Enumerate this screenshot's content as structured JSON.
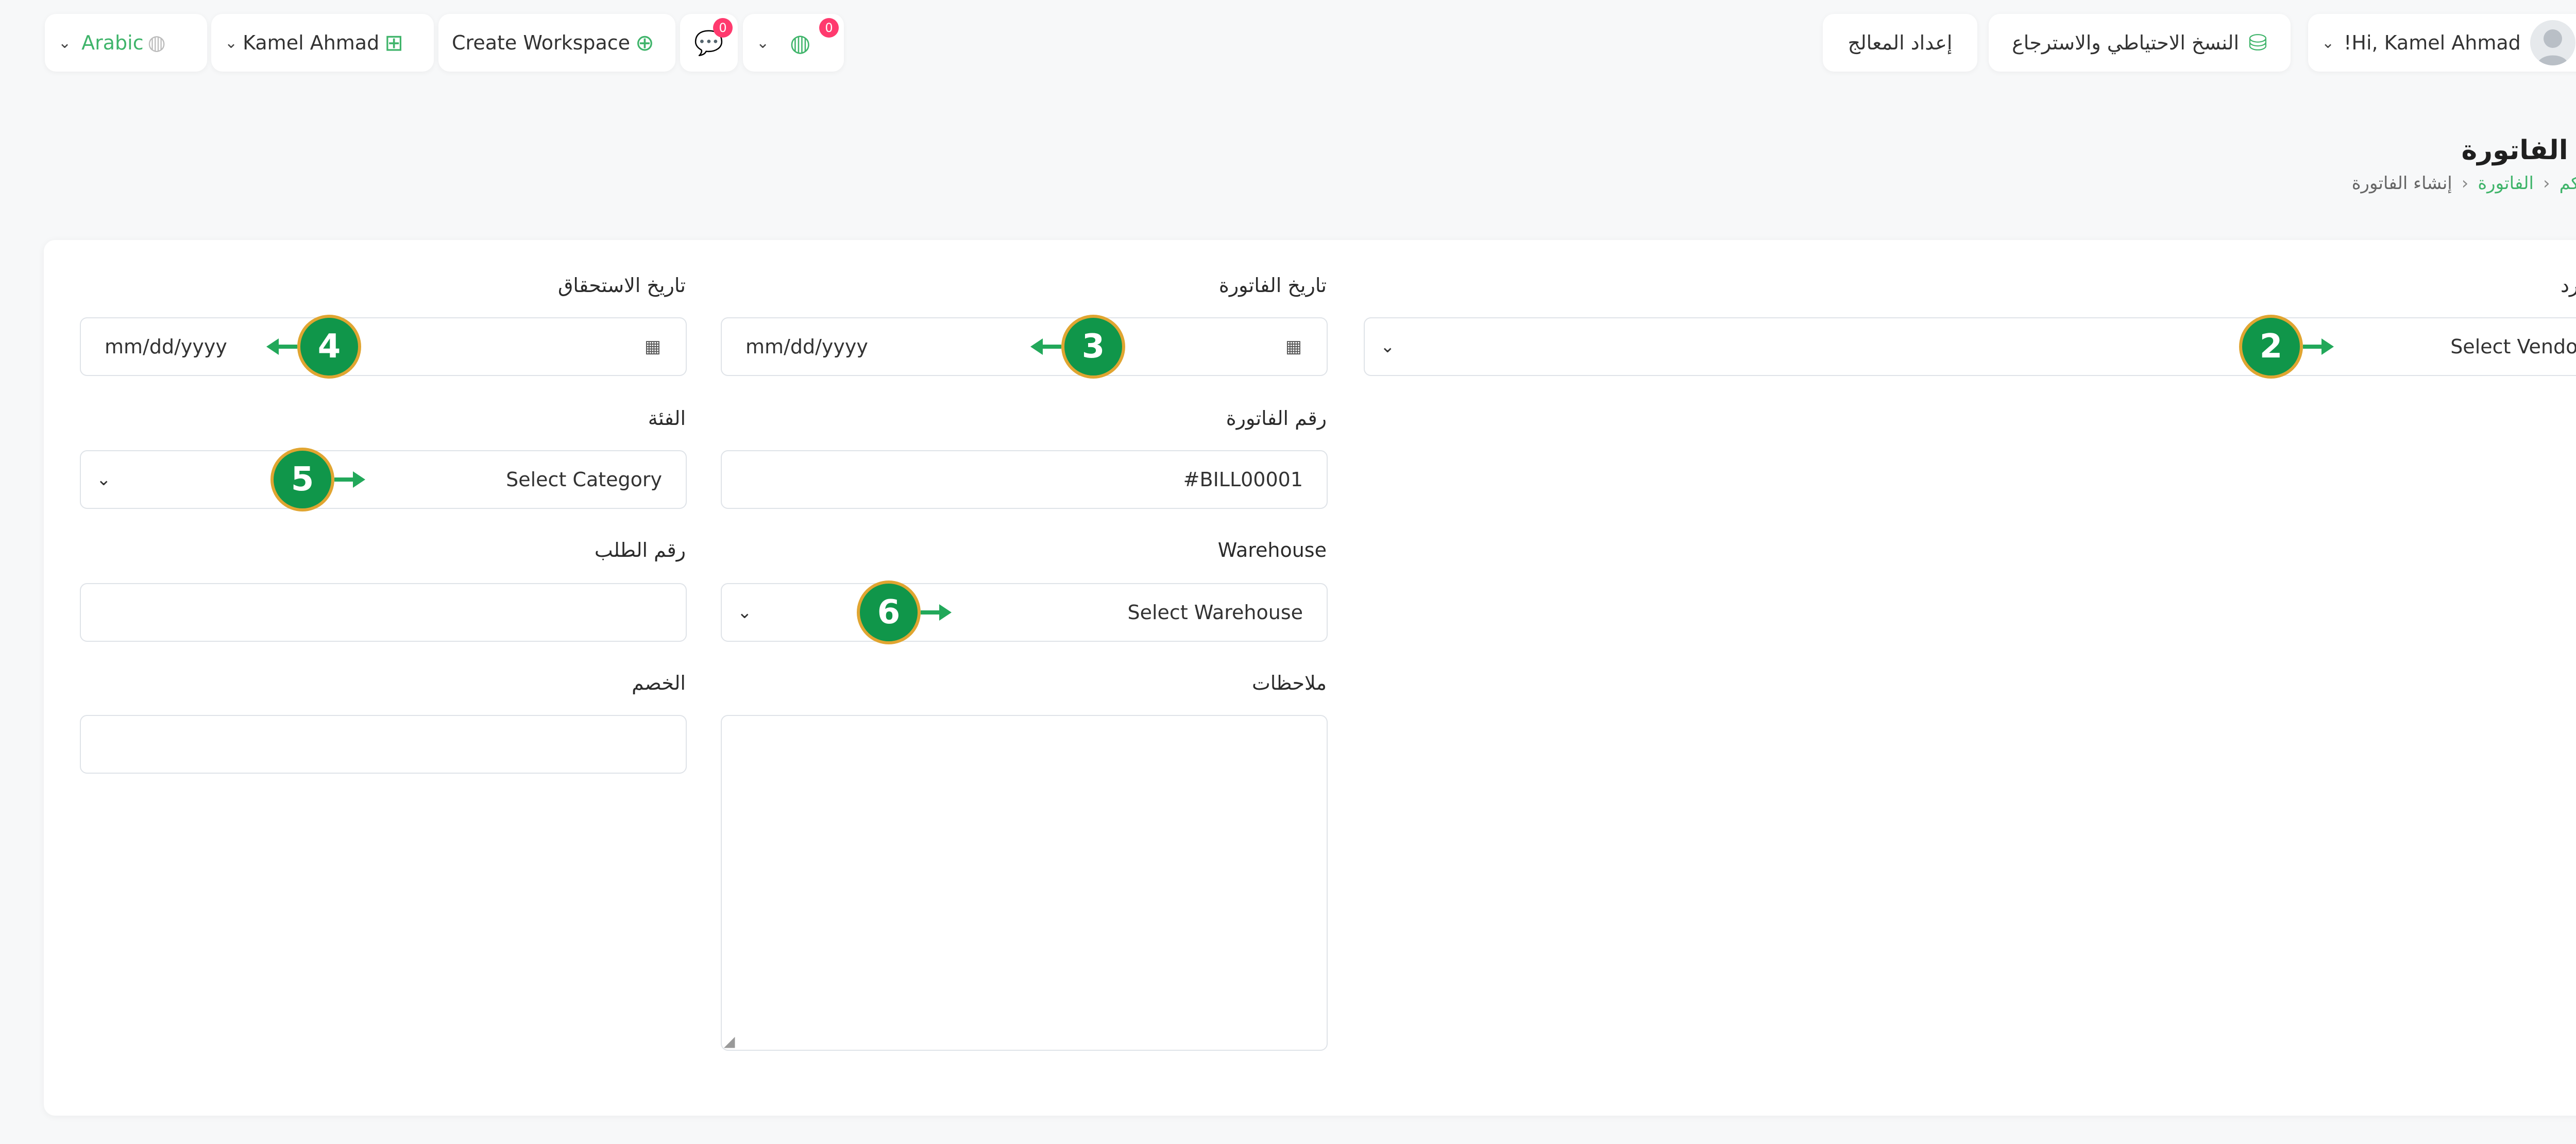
{
  "topbar": {
    "language_label": "Arabic",
    "user_menu_label": "Kamel Ahmad",
    "create_workspace_label": "Create Workspace",
    "messages_badge": "0",
    "notifications_badge": "0",
    "wizard_label": "إعداد المعالج",
    "backup_label": "النسخ الاحتياطي والاسترجاع",
    "greeting": "Hi, Kamel Ahmad!"
  },
  "page": {
    "title": "إنشاء الفاتورة",
    "breadcrumb": [
      "لوحة التحكم",
      "الفاتورة",
      "إنشاء الفاتورة"
    ]
  },
  "form": {
    "vendor": {
      "label": "المورد",
      "placeholder": "Select Vendor"
    },
    "bill_date": {
      "label": "تاريخ الفاتورة",
      "placeholder": "mm/dd/yyyy"
    },
    "due_date": {
      "label": "تاريخ الاستحقاق",
      "placeholder": "mm/dd/yyyy"
    },
    "bill_number": {
      "label": "رقم الفاتورة",
      "value": "#BILL00001"
    },
    "category": {
      "label": "الفئة",
      "placeholder": "Select Category"
    },
    "warehouse": {
      "label": "Warehouse",
      "placeholder": "Select Warehouse"
    },
    "order_number": {
      "label": "رقم الطلب",
      "value": ""
    },
    "notes": {
      "label": "ملاحظات"
    },
    "discount": {
      "label": "الخصم",
      "value": ""
    }
  },
  "markers": [
    "2",
    "3",
    "4",
    "5",
    "6"
  ],
  "colors": {
    "accent": "#3fb46a",
    "marker_fill": "#10964a",
    "marker_ring": "#e0a531",
    "badge": "#ff3a6e"
  }
}
